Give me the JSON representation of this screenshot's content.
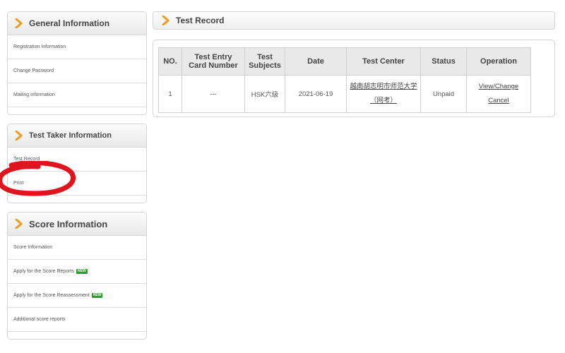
{
  "sidebar": {
    "general": {
      "title": "General Information",
      "items": [
        "Registration Information",
        "Change Password",
        "Mailing information"
      ]
    },
    "test_taker": {
      "title": "Test Taker Information",
      "items": [
        "Test Record",
        "Print"
      ]
    },
    "score": {
      "title": "Score Information",
      "items": [
        {
          "label": "Score Information",
          "badge": ""
        },
        {
          "label": "Apply for the Score Reports",
          "badge": "NEW"
        },
        {
          "label": "Apply for the Score Reassessment",
          "badge": "NEW"
        },
        {
          "label": "Additional score reports",
          "badge": ""
        }
      ]
    }
  },
  "main": {
    "title": "Test Record",
    "table": {
      "headers": [
        "NO.",
        "Test Entry Card Number",
        "Test Subjects",
        "Date",
        "Test Center",
        "Status",
        "Operation"
      ],
      "rows": [
        {
          "no": "1",
          "card": "---",
          "subject": "HSK六级",
          "date": "2021-06-19",
          "center_line1": "越南胡志明市师范大学",
          "center_line2": "（网考）",
          "status": "Unpaid",
          "op_view": "View/Change",
          "op_cancel": "Cancel"
        }
      ]
    }
  },
  "colors": {
    "accent_chevron": "#f29a1a",
    "annotation": "#e0141c",
    "new_badge": "#1fa51f"
  },
  "icons": {
    "panel_chevron": "chevron-right-icon"
  }
}
